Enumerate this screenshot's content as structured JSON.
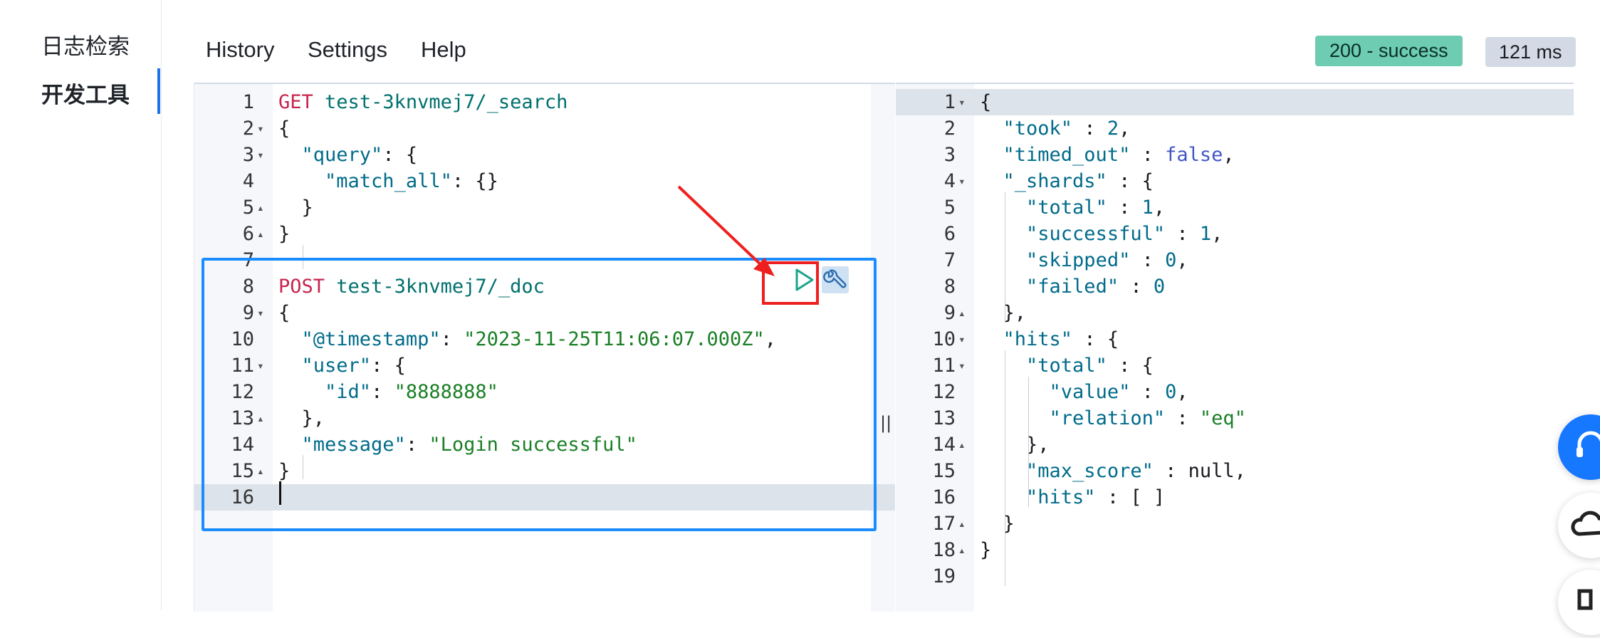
{
  "sidebar": {
    "items": [
      {
        "label": "日志检索",
        "active": false
      },
      {
        "label": "开发工具",
        "active": true
      }
    ]
  },
  "menu": {
    "history": "History",
    "settings": "Settings",
    "help": "Help"
  },
  "status": {
    "code_label": "200 - success",
    "time_label": "121 ms",
    "success_color": "#6dccb1"
  },
  "request_editor": {
    "lines": [
      {
        "n": "1",
        "fold": "",
        "tokens": [
          [
            "GET",
            "k-method"
          ],
          [
            " ",
            "k-punc"
          ],
          [
            "test-3knvmej7/_search",
            "k-url"
          ]
        ]
      },
      {
        "n": "2",
        "fold": "▾",
        "tokens": [
          [
            "{",
            "k-punc"
          ]
        ]
      },
      {
        "n": "3",
        "fold": "▾",
        "tokens": [
          [
            "  ",
            "k-punc"
          ],
          [
            "\"query\"",
            "k-key"
          ],
          [
            ": {",
            "k-punc"
          ]
        ]
      },
      {
        "n": "4",
        "fold": "",
        "tokens": [
          [
            "    ",
            "k-punc"
          ],
          [
            "\"match_all\"",
            "k-key"
          ],
          [
            ": {}",
            "k-punc"
          ]
        ]
      },
      {
        "n": "5",
        "fold": "▴",
        "tokens": [
          [
            "  }",
            "k-punc"
          ]
        ]
      },
      {
        "n": "6",
        "fold": "▴",
        "tokens": [
          [
            "}",
            "k-punc"
          ]
        ]
      },
      {
        "n": "7",
        "fold": "",
        "tokens": []
      },
      {
        "n": "8",
        "fold": "",
        "tokens": [
          [
            "POST",
            "k-method"
          ],
          [
            " ",
            "k-punc"
          ],
          [
            "test-3knvmej7/_doc",
            "k-url"
          ]
        ]
      },
      {
        "n": "9",
        "fold": "▾",
        "tokens": [
          [
            "{",
            "k-punc"
          ]
        ]
      },
      {
        "n": "10",
        "fold": "",
        "tokens": [
          [
            "  ",
            "k-punc"
          ],
          [
            "\"@timestamp\"",
            "k-key"
          ],
          [
            ": ",
            "k-punc"
          ],
          [
            "\"2023-11-25T11:06:07.000Z\"",
            "k-str"
          ],
          [
            ",",
            "k-punc"
          ]
        ]
      },
      {
        "n": "11",
        "fold": "▾",
        "tokens": [
          [
            "  ",
            "k-punc"
          ],
          [
            "\"user\"",
            "k-key"
          ],
          [
            ": {",
            "k-punc"
          ]
        ]
      },
      {
        "n": "12",
        "fold": "",
        "tokens": [
          [
            "    ",
            "k-punc"
          ],
          [
            "\"id\"",
            "k-key"
          ],
          [
            ": ",
            "k-punc"
          ],
          [
            "\"8888888\"",
            "k-str"
          ]
        ]
      },
      {
        "n": "13",
        "fold": "▴",
        "tokens": [
          [
            "  },",
            "k-punc"
          ]
        ]
      },
      {
        "n": "14",
        "fold": "",
        "tokens": [
          [
            "  ",
            "k-punc"
          ],
          [
            "\"message\"",
            "k-key"
          ],
          [
            ": ",
            "k-punc"
          ],
          [
            "\"Login successful\"",
            "k-str"
          ]
        ]
      },
      {
        "n": "15",
        "fold": "▴",
        "tokens": [
          [
            "}",
            "k-punc"
          ]
        ]
      },
      {
        "n": "16",
        "fold": "",
        "tokens": []
      }
    ]
  },
  "response_viewer": {
    "lines": [
      {
        "n": "1",
        "fold": "▾",
        "tokens": [
          [
            "{",
            "k-punc"
          ]
        ]
      },
      {
        "n": "2",
        "fold": "",
        "tokens": [
          [
            "  ",
            "k-punc"
          ],
          [
            "\"took\"",
            "k-key"
          ],
          [
            " : ",
            "k-punc"
          ],
          [
            "2",
            "k-num"
          ],
          [
            ",",
            "k-punc"
          ]
        ]
      },
      {
        "n": "3",
        "fold": "",
        "tokens": [
          [
            "  ",
            "k-punc"
          ],
          [
            "\"timed_out\"",
            "k-key"
          ],
          [
            " : ",
            "k-punc"
          ],
          [
            "false",
            "k-bool"
          ],
          [
            ",",
            "k-punc"
          ]
        ]
      },
      {
        "n": "4",
        "fold": "▾",
        "tokens": [
          [
            "  ",
            "k-punc"
          ],
          [
            "\"_shards\"",
            "k-key"
          ],
          [
            " : {",
            "k-punc"
          ]
        ]
      },
      {
        "n": "5",
        "fold": "",
        "tokens": [
          [
            "    ",
            "k-punc"
          ],
          [
            "\"total\"",
            "k-key"
          ],
          [
            " : ",
            "k-punc"
          ],
          [
            "1",
            "k-num"
          ],
          [
            ",",
            "k-punc"
          ]
        ]
      },
      {
        "n": "6",
        "fold": "",
        "tokens": [
          [
            "    ",
            "k-punc"
          ],
          [
            "\"successful\"",
            "k-key"
          ],
          [
            " : ",
            "k-punc"
          ],
          [
            "1",
            "k-num"
          ],
          [
            ",",
            "k-punc"
          ]
        ]
      },
      {
        "n": "7",
        "fold": "",
        "tokens": [
          [
            "    ",
            "k-punc"
          ],
          [
            "\"skipped\"",
            "k-key"
          ],
          [
            " : ",
            "k-punc"
          ],
          [
            "0",
            "k-num"
          ],
          [
            ",",
            "k-punc"
          ]
        ]
      },
      {
        "n": "8",
        "fold": "",
        "tokens": [
          [
            "    ",
            "k-punc"
          ],
          [
            "\"failed\"",
            "k-key"
          ],
          [
            " : ",
            "k-punc"
          ],
          [
            "0",
            "k-num"
          ]
        ]
      },
      {
        "n": "9",
        "fold": "▴",
        "tokens": [
          [
            "  },",
            "k-punc"
          ]
        ]
      },
      {
        "n": "10",
        "fold": "▾",
        "tokens": [
          [
            "  ",
            "k-punc"
          ],
          [
            "\"hits\"",
            "k-key"
          ],
          [
            " : {",
            "k-punc"
          ]
        ]
      },
      {
        "n": "11",
        "fold": "▾",
        "tokens": [
          [
            "    ",
            "k-punc"
          ],
          [
            "\"total\"",
            "k-key"
          ],
          [
            " : {",
            "k-punc"
          ]
        ]
      },
      {
        "n": "12",
        "fold": "",
        "tokens": [
          [
            "      ",
            "k-punc"
          ],
          [
            "\"value\"",
            "k-key"
          ],
          [
            " : ",
            "k-punc"
          ],
          [
            "0",
            "k-num"
          ],
          [
            ",",
            "k-punc"
          ]
        ]
      },
      {
        "n": "13",
        "fold": "",
        "tokens": [
          [
            "      ",
            "k-punc"
          ],
          [
            "\"relation\"",
            "k-key"
          ],
          [
            " : ",
            "k-punc"
          ],
          [
            "\"eq\"",
            "k-str"
          ]
        ]
      },
      {
        "n": "14",
        "fold": "▴",
        "tokens": [
          [
            "    },",
            "k-punc"
          ]
        ]
      },
      {
        "n": "15",
        "fold": "",
        "tokens": [
          [
            "    ",
            "k-punc"
          ],
          [
            "\"max_score\"",
            "k-key"
          ],
          [
            " : null,",
            "k-punc"
          ]
        ]
      },
      {
        "n": "16",
        "fold": "",
        "tokens": [
          [
            "    ",
            "k-punc"
          ],
          [
            "\"hits\"",
            "k-key"
          ],
          [
            " : [ ]",
            "k-punc"
          ]
        ]
      },
      {
        "n": "17",
        "fold": "▴",
        "tokens": [
          [
            "  }",
            "k-punc"
          ]
        ]
      },
      {
        "n": "18",
        "fold": "▴",
        "tokens": [
          [
            "}",
            "k-punc"
          ]
        ]
      },
      {
        "n": "19",
        "fold": "",
        "tokens": []
      }
    ]
  },
  "icons": {
    "run": "play-icon",
    "settings": "wrench-icon",
    "support": "headset-icon",
    "cloud": "cloud-icon",
    "docs": "book-icon"
  },
  "colors": {
    "accent": "#1a73e8",
    "annotation_blue": "#1a8cff",
    "annotation_red": "#f01f1f"
  }
}
